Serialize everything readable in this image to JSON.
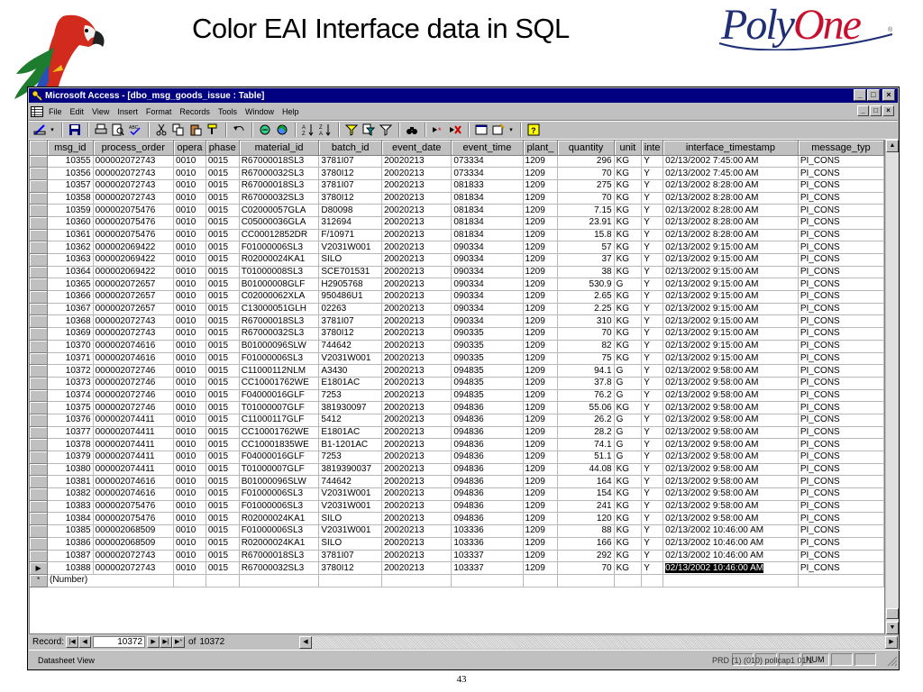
{
  "slide": {
    "title": "Color EAI Interface data in SQL",
    "logo_left": "Poly",
    "logo_right": "One",
    "logo_mark": "®",
    "page_number": "43"
  },
  "window": {
    "title": "Microsoft Access - [dbo_msg_goods_issue : Table]",
    "min": "_",
    "max": "□",
    "close": "×"
  },
  "menu": [
    "File",
    "Edit",
    "View",
    "Insert",
    "Format",
    "Records",
    "Tools",
    "Window",
    "Help"
  ],
  "menu_underline": [
    "F",
    "E",
    "V",
    "I",
    "o",
    "R",
    "T",
    "W",
    "H"
  ],
  "columns": [
    "msg_id",
    "process_order",
    "opera",
    "phase",
    "material_id",
    "batch_id",
    "event_date",
    "event_time",
    "plant_",
    "quantity",
    "unit",
    "inte",
    "interface_timestamp",
    "message_typ"
  ],
  "rows": [
    [
      "10355",
      "000002072743",
      "0010",
      "0015",
      "R67000018SL3",
      "3781I07",
      "20020213",
      "073334",
      "1209",
      "296",
      "KG",
      "Y",
      "02/13/2002 7:45:00 AM",
      "PI_CONS"
    ],
    [
      "10356",
      "000002072743",
      "0010",
      "0015",
      "R67000032SL3",
      "3780I12",
      "20020213",
      "073334",
      "1209",
      "70",
      "KG",
      "Y",
      "02/13/2002 7:45:00 AM",
      "PI_CONS"
    ],
    [
      "10357",
      "000002072743",
      "0010",
      "0015",
      "R67000018SL3",
      "3781I07",
      "20020213",
      "081833",
      "1209",
      "275",
      "KG",
      "Y",
      "02/13/2002 8:28:00 AM",
      "PI_CONS"
    ],
    [
      "10358",
      "000002072743",
      "0010",
      "0015",
      "R67000032SL3",
      "3780I12",
      "20020213",
      "081834",
      "1209",
      "70",
      "KG",
      "Y",
      "02/13/2002 8:28:00 AM",
      "PI_CONS"
    ],
    [
      "10359",
      "000002075476",
      "0010",
      "0015",
      "C02000057GLA",
      "D80098",
      "20020213",
      "081834",
      "1209",
      "7.15",
      "KG",
      "Y",
      "02/13/2002 8:28:00 AM",
      "PI_CONS"
    ],
    [
      "10360",
      "000002075476",
      "0010",
      "0015",
      "C05000036GLA",
      "312694",
      "20020213",
      "081834",
      "1209",
      "23.91",
      "KG",
      "Y",
      "02/13/2002 8:28:00 AM",
      "PI_CONS"
    ],
    [
      "10361",
      "000002075476",
      "0010",
      "0015",
      "CC00012852DR",
      "F/10971",
      "20020213",
      "081834",
      "1209",
      "15.8",
      "KG",
      "Y",
      "02/13/2002 8:28:00 AM",
      "PI_CONS"
    ],
    [
      "10362",
      "000002069422",
      "0010",
      "0015",
      "F01000006SL3",
      "V2031W001",
      "20020213",
      "090334",
      "1209",
      "57",
      "KG",
      "Y",
      "02/13/2002 9:15:00 AM",
      "PI_CONS"
    ],
    [
      "10363",
      "000002069422",
      "0010",
      "0015",
      "R02000024KA1",
      "SILO",
      "20020213",
      "090334",
      "1209",
      "37",
      "KG",
      "Y",
      "02/13/2002 9:15:00 AM",
      "PI_CONS"
    ],
    [
      "10364",
      "000002069422",
      "0010",
      "0015",
      "T01000008SL3",
      "SCE701531",
      "20020213",
      "090334",
      "1209",
      "38",
      "KG",
      "Y",
      "02/13/2002 9:15:00 AM",
      "PI_CONS"
    ],
    [
      "10365",
      "000002072657",
      "0010",
      "0015",
      "B01000008GLF",
      "H2905768",
      "20020213",
      "090334",
      "1209",
      "530.9",
      "G",
      "Y",
      "02/13/2002 9:15:00 AM",
      "PI_CONS"
    ],
    [
      "10366",
      "000002072657",
      "0010",
      "0015",
      "C02000062XLA",
      "950486U1",
      "20020213",
      "090334",
      "1209",
      "2.65",
      "KG",
      "Y",
      "02/13/2002 9:15:00 AM",
      "PI_CONS"
    ],
    [
      "10367",
      "000002072657",
      "0010",
      "0015",
      "C13000051GLH",
      "02263",
      "20020213",
      "090334",
      "1209",
      "2.25",
      "KG",
      "Y",
      "02/13/2002 9:15:00 AM",
      "PI_CONS"
    ],
    [
      "10368",
      "000002072743",
      "0010",
      "0015",
      "R67000018SL3",
      "3781I07",
      "20020213",
      "090334",
      "1209",
      "310",
      "KG",
      "Y",
      "02/13/2002 9:15:00 AM",
      "PI_CONS"
    ],
    [
      "10369",
      "000002072743",
      "0010",
      "0015",
      "R67000032SL3",
      "3780I12",
      "20020213",
      "090335",
      "1209",
      "70",
      "KG",
      "Y",
      "02/13/2002 9:15:00 AM",
      "PI_CONS"
    ],
    [
      "10370",
      "000002074616",
      "0010",
      "0015",
      "B01000096SLW",
      "744642",
      "20020213",
      "090335",
      "1209",
      "82",
      "KG",
      "Y",
      "02/13/2002 9:15:00 AM",
      "PI_CONS"
    ],
    [
      "10371",
      "000002074616",
      "0010",
      "0015",
      "F01000006SL3",
      "V2031W001",
      "20020213",
      "090335",
      "1209",
      "75",
      "KG",
      "Y",
      "02/13/2002 9:15:00 AM",
      "PI_CONS"
    ],
    [
      "10372",
      "000002072746",
      "0010",
      "0015",
      "C11000112NLM",
      "A3430",
      "20020213",
      "094835",
      "1209",
      "94.1",
      "G",
      "Y",
      "02/13/2002 9:58:00 AM",
      "PI_CONS"
    ],
    [
      "10373",
      "000002072746",
      "0010",
      "0015",
      "CC10001762WE",
      "E1801AC",
      "20020213",
      "094835",
      "1209",
      "37.8",
      "G",
      "Y",
      "02/13/2002 9:58:00 AM",
      "PI_CONS"
    ],
    [
      "10374",
      "000002072746",
      "0010",
      "0015",
      "F04000016GLF",
      "7253",
      "20020213",
      "094835",
      "1209",
      "76.2",
      "G",
      "Y",
      "02/13/2002 9:58:00 AM",
      "PI_CONS"
    ],
    [
      "10375",
      "000002072746",
      "0010",
      "0015",
      "T01000007GLF",
      "381930097",
      "20020213",
      "094836",
      "1209",
      "55.06",
      "KG",
      "Y",
      "02/13/2002 9:58:00 AM",
      "PI_CONS"
    ],
    [
      "10376",
      "000002074411",
      "0010",
      "0015",
      "C11000117GLF",
      "5412",
      "20020213",
      "094836",
      "1209",
      "26.2",
      "G",
      "Y",
      "02/13/2002 9:58:00 AM",
      "PI_CONS"
    ],
    [
      "10377",
      "000002074411",
      "0010",
      "0015",
      "CC10001762WE",
      "E1801AC",
      "20020213",
      "094836",
      "1209",
      "28.2",
      "G",
      "Y",
      "02/13/2002 9:58:00 AM",
      "PI_CONS"
    ],
    [
      "10378",
      "000002074411",
      "0010",
      "0015",
      "CC10001835WE",
      "B1-1201AC",
      "20020213",
      "094836",
      "1209",
      "74.1",
      "G",
      "Y",
      "02/13/2002 9:58:00 AM",
      "PI_CONS"
    ],
    [
      "10379",
      "000002074411",
      "0010",
      "0015",
      "F04000016GLF",
      "7253",
      "20020213",
      "094836",
      "1209",
      "51.1",
      "G",
      "Y",
      "02/13/2002 9:58:00 AM",
      "PI_CONS"
    ],
    [
      "10380",
      "000002074411",
      "0010",
      "0015",
      "T01000007GLF",
      "3819390037",
      "20020213",
      "094836",
      "1209",
      "44.08",
      "KG",
      "Y",
      "02/13/2002 9:58:00 AM",
      "PI_CONS"
    ],
    [
      "10381",
      "000002074616",
      "0010",
      "0015",
      "B01000096SLW",
      "744642",
      "20020213",
      "094836",
      "1209",
      "164",
      "KG",
      "Y",
      "02/13/2002 9:58:00 AM",
      "PI_CONS"
    ],
    [
      "10382",
      "000002074616",
      "0010",
      "0015",
      "F01000006SL3",
      "V2031W001",
      "20020213",
      "094836",
      "1209",
      "154",
      "KG",
      "Y",
      "02/13/2002 9:58:00 AM",
      "PI_CONS"
    ],
    [
      "10383",
      "000002075476",
      "0010",
      "0015",
      "F01000006SL3",
      "V2031W001",
      "20020213",
      "094836",
      "1209",
      "241",
      "KG",
      "Y",
      "02/13/2002 9:58:00 AM",
      "PI_CONS"
    ],
    [
      "10384",
      "000002075476",
      "0010",
      "0015",
      "R02000024KA1",
      "SILO",
      "20020213",
      "094836",
      "1209",
      "120",
      "KG",
      "Y",
      "02/13/2002 9:58:00 AM",
      "PI_CONS"
    ],
    [
      "10385",
      "000002068509",
      "0010",
      "0015",
      "F01000006SL3",
      "V2031W001",
      "20020213",
      "103336",
      "1209",
      "88",
      "KG",
      "Y",
      "02/13/2002 10:46:00 AM",
      "PI_CONS"
    ],
    [
      "10386",
      "000002068509",
      "0010",
      "0015",
      "R02000024KA1",
      "SILO",
      "20020213",
      "103336",
      "1209",
      "166",
      "KG",
      "Y",
      "02/13/2002 10:46:00 AM",
      "PI_CONS"
    ],
    [
      "10387",
      "000002072743",
      "0010",
      "0015",
      "R67000018SL3",
      "3781I07",
      "20020213",
      "103337",
      "1209",
      "292",
      "KG",
      "Y",
      "02/13/2002 10:46:00 AM",
      "PI_CONS"
    ],
    [
      "10388",
      "000002072743",
      "0010",
      "0015",
      "R67000032SL3",
      "3780I12",
      "20020213",
      "103337",
      "1209",
      "70",
      "KG",
      "Y",
      "02/13/2002 10:46:00 AM",
      "PI_CONS"
    ]
  ],
  "current_row_index": 33,
  "new_row_text": "(Number)",
  "new_row_marker": "*",
  "current_row_marker": "▶",
  "navigation": {
    "label": "Record:",
    "current": "10372",
    "of_label": "of",
    "total": "10372"
  },
  "status": {
    "text": "Datasheet View",
    "num": "NUM"
  },
  "bleed_text": "PRD (1) (010)   pollcap1   01/1",
  "colors": {
    "title_bar": "#000080",
    "chrome": "#c0c0c0",
    "logo_blue": "#1f2f76",
    "logo_red": "#c8102e"
  }
}
